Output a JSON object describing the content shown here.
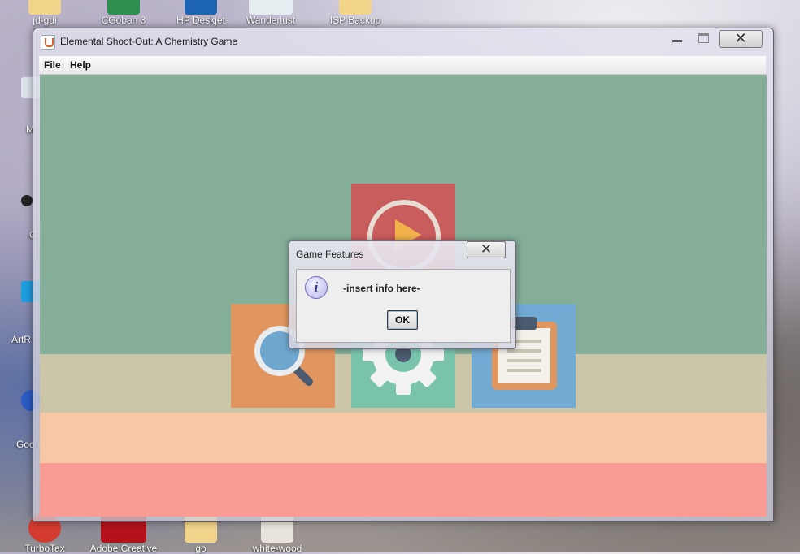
{
  "desktop": {
    "top_icons": [
      {
        "label": "jd-gui",
        "icon": "jar-icon",
        "color": "#f0d48a"
      },
      {
        "label": "CGoban 3",
        "icon": "cgoban-icon",
        "color": "#2f8f4e"
      },
      {
        "label": "HP Deskjet",
        "icon": "hp-icon",
        "color": "#1c63b1"
      },
      {
        "label": "Wanderlust",
        "icon": "document-icon",
        "color": "#e7eef2"
      },
      {
        "label": "ISP Backup",
        "icon": "folder-icon",
        "color": "#f2d48b"
      }
    ],
    "bottom_icons": [
      {
        "label": "TurboTax",
        "icon": "turbotax-icon",
        "color": "#d43b2f"
      },
      {
        "label": "Adobe Creative",
        "icon": "adobe-icon",
        "color": "#b3121a"
      },
      {
        "label": "go",
        "icon": "folder-icon",
        "color": "#f2d48b"
      },
      {
        "label": "white-wood",
        "icon": "image-icon",
        "color": "#e8e4dc"
      }
    ],
    "left_labels": [
      "M",
      "C",
      "ArtR",
      "Goo"
    ]
  },
  "window": {
    "title": "Elemental Shoot-Out: A Chemistry Game",
    "menu": [
      "File",
      "Help"
    ],
    "close_glyph": "✕"
  },
  "game": {
    "tiles": [
      {
        "name": "play",
        "icon": "play-icon",
        "color": "#c95c5c"
      },
      {
        "name": "search",
        "icon": "magnifier-icon",
        "color": "#e0965e"
      },
      {
        "name": "settings",
        "icon": "gear-icon",
        "color": "#79c3ac"
      },
      {
        "name": "notes",
        "icon": "clipboard-icon",
        "color": "#71abd4"
      }
    ],
    "band_colors": [
      "#84ae98",
      "#cbc6a8",
      "#f6c8a6",
      "#f99c93"
    ]
  },
  "dialog": {
    "title": "Game Features",
    "message": "-insert info here-",
    "ok_label": "OK",
    "info_glyph": "i",
    "close_glyph": "✕"
  }
}
